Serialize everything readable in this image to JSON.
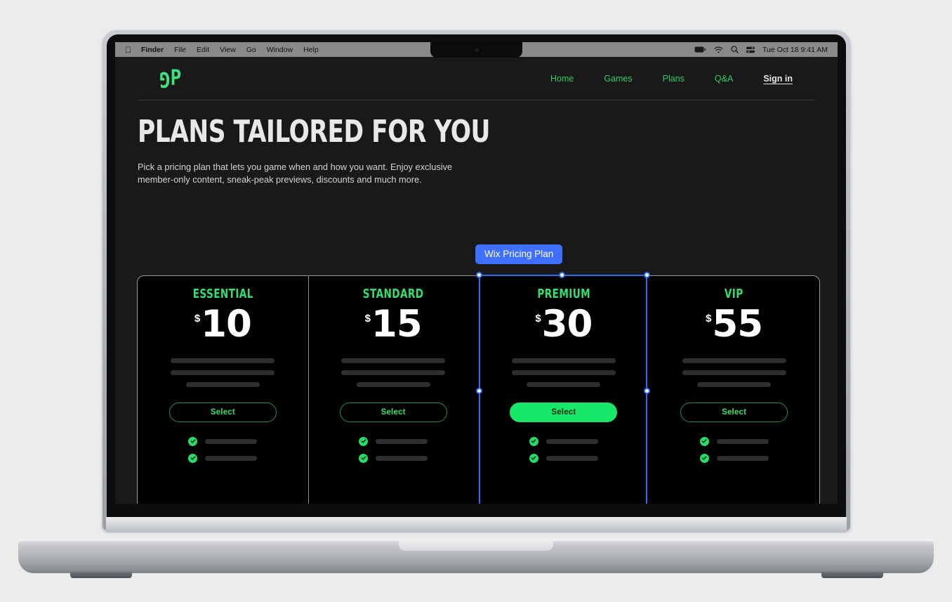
{
  "os_menubar": {
    "apple_icon": "apple-logo-icon",
    "items": [
      "Finder",
      "File",
      "Edit",
      "View",
      "Go",
      "Window",
      "Help"
    ],
    "status_icons": [
      "battery-icon",
      "wifi-icon",
      "search-icon",
      "control-center-icon"
    ],
    "clock": "Tue Oct 18  9:41 AM"
  },
  "site": {
    "logo": "GP",
    "nav": {
      "links": [
        "Home",
        "Games",
        "Plans",
        "Q&A"
      ],
      "signin": "Sign in"
    },
    "hero": {
      "title": "PLANS TAILORED FOR YOU",
      "subtitle": "Pick a pricing plan that lets you game when and how you want. Enjoy exclusive member-only content, sneak-peak previews, discounts and much more."
    }
  },
  "editor": {
    "selection_label": "Wix Pricing Plan",
    "selection_color": "#3e6fff",
    "selected_plan_index": 2
  },
  "theme": {
    "accent_green": "#2ee06e",
    "button_green": "#17e86a",
    "page_background": "#191919",
    "card_background": "#000000"
  },
  "plans": [
    {
      "name": "ESSENTIAL",
      "currency": "$",
      "price": "10",
      "cta": "Select",
      "selected": false,
      "feature_count": 2
    },
    {
      "name": "STANDARD",
      "currency": "$",
      "price": "15",
      "cta": "Select",
      "selected": false,
      "feature_count": 2
    },
    {
      "name": "PREMIUM",
      "currency": "$",
      "price": "30",
      "cta": "Select",
      "selected": true,
      "feature_count": 2
    },
    {
      "name": "VIP",
      "currency": "$",
      "price": "55",
      "cta": "Select",
      "selected": false,
      "feature_count": 2
    }
  ]
}
